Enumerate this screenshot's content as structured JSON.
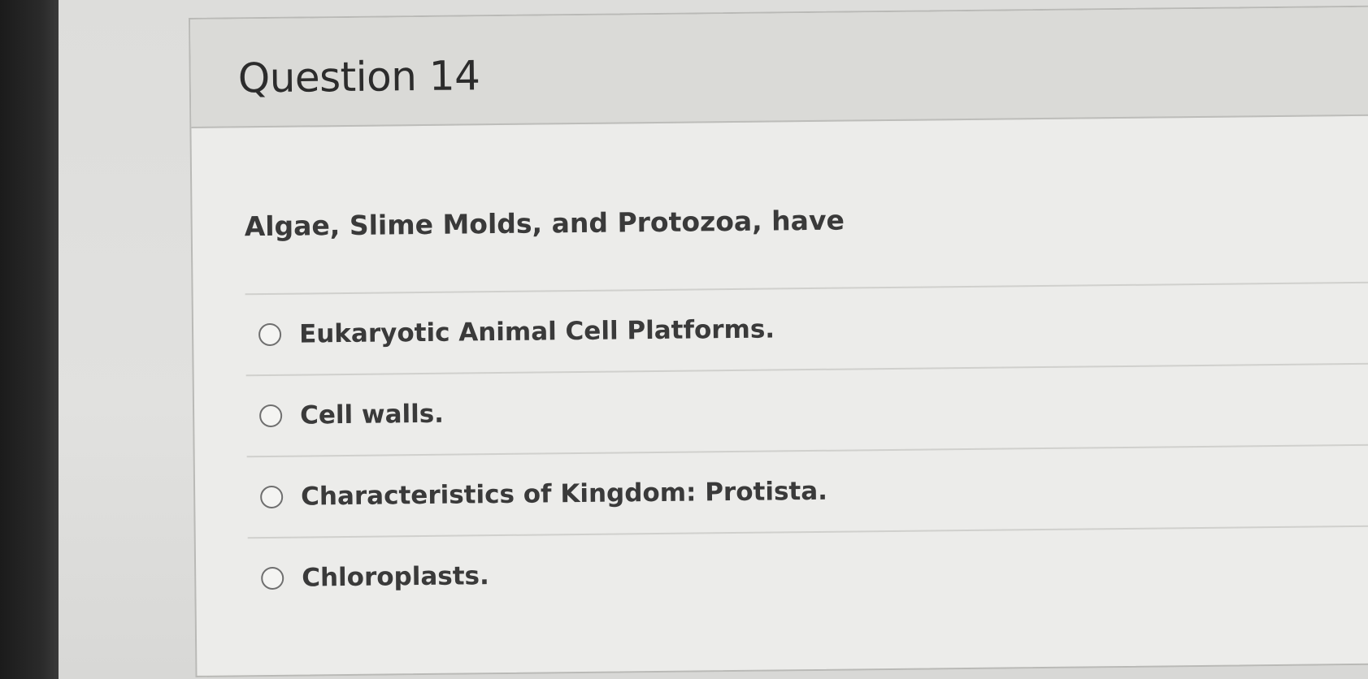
{
  "question": {
    "title": "Question 14",
    "text": "Algae, Slime Molds, and Protozoa, have",
    "answers": [
      {
        "label": "Eukaryotic Animal Cell Platforms."
      },
      {
        "label": "Cell walls."
      },
      {
        "label": "Characteristics of Kingdom: Protista."
      },
      {
        "label": "Chloroplasts."
      }
    ]
  }
}
